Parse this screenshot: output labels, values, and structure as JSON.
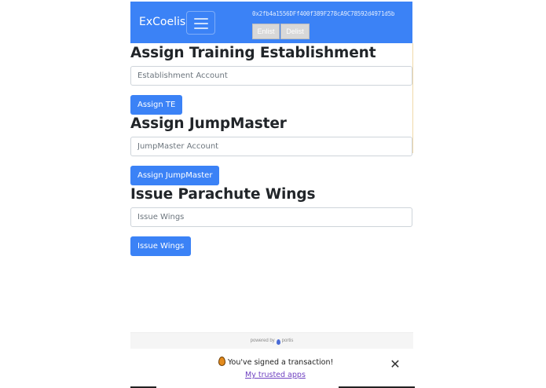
{
  "navbar": {
    "brand": "ExCoelis",
    "address": "0x2fb4a1556DFf400f389F278cA9C78592d4971d5b",
    "enlist_label": "Enlist",
    "delist_label": "Delist"
  },
  "sections": [
    {
      "title": "Assign Training Establishment",
      "placeholder": "Establishment Account",
      "button": "Assign TE"
    },
    {
      "title": "Assign JumpMaster",
      "placeholder": "JumpMaster Account",
      "button": "Assign JumpMaster"
    },
    {
      "title": "Issue Parachute Wings",
      "placeholder": "Issue Wings",
      "button": "Issue Wings"
    }
  ],
  "portis": {
    "powered_by": "powered by",
    "brand": "portis"
  },
  "toast": {
    "message": "You've signed a transaction!",
    "link": "My trusted apps",
    "close": "✕"
  },
  "colors": {
    "primary": "#3b82f6",
    "link": "#6f42c1"
  }
}
